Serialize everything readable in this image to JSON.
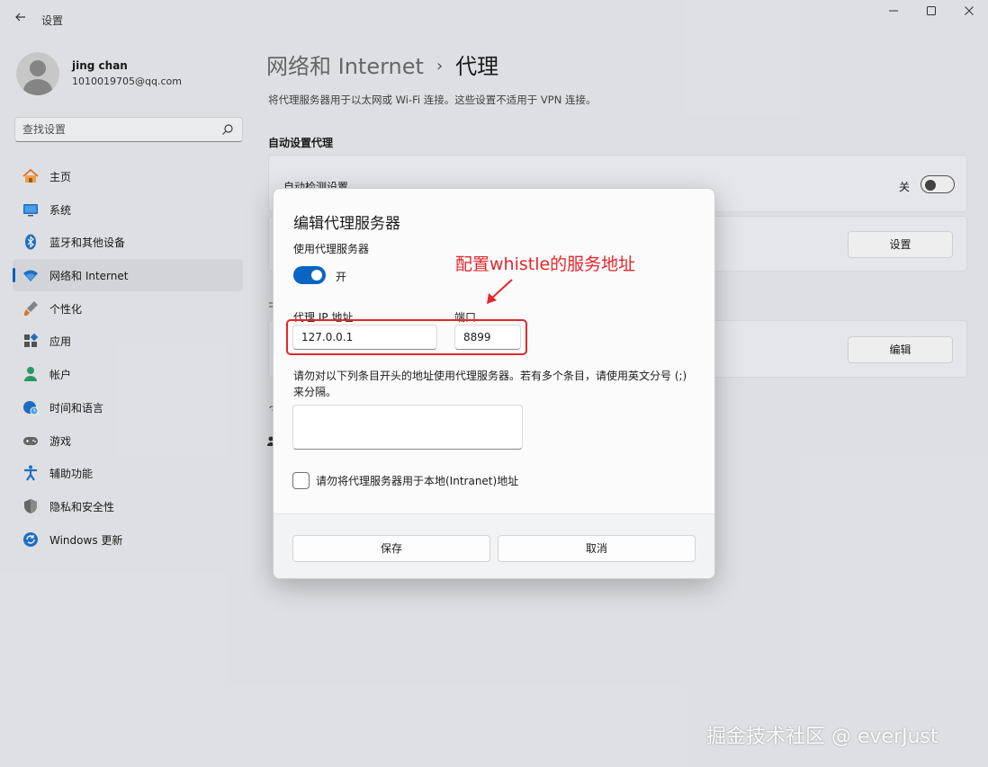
{
  "window": {
    "title": "设置"
  },
  "user": {
    "name": "jing chan",
    "email": "1010019705@qq.com"
  },
  "search": {
    "placeholder": "查找设置"
  },
  "sidebar": {
    "items": [
      {
        "label": "主页",
        "icon": "home-icon"
      },
      {
        "label": "系统",
        "icon": "system-icon"
      },
      {
        "label": "蓝牙和其他设备",
        "icon": "bluetooth-icon"
      },
      {
        "label": "网络和 Internet",
        "icon": "wifi-icon",
        "active": true
      },
      {
        "label": "个性化",
        "icon": "brush-icon"
      },
      {
        "label": "应用",
        "icon": "apps-icon"
      },
      {
        "label": "帐户",
        "icon": "account-icon"
      },
      {
        "label": "时间和语言",
        "icon": "globe-clock-icon"
      },
      {
        "label": "游戏",
        "icon": "gamepad-icon"
      },
      {
        "label": "辅助功能",
        "icon": "accessibility-icon"
      },
      {
        "label": "隐私和安全性",
        "icon": "shield-icon"
      },
      {
        "label": "Windows 更新",
        "icon": "update-icon"
      }
    ]
  },
  "main": {
    "breadcrumb_parent": "网络和 Internet",
    "breadcrumb_separator": "›",
    "breadcrumb_current": "代理",
    "description": "将代理服务器用于以太网或 Wi-Fi 连接。这些设置不适用于 VPN 连接。",
    "auto_section_title": "自动设置代理",
    "auto_detect_label": "自动检测设置",
    "auto_detect_state": "关",
    "setup_script_button": "设置",
    "manual_edit_button": "编辑"
  },
  "dialog": {
    "title": "编辑代理服务器",
    "use_proxy_label": "使用代理服务器",
    "use_proxy_state": "开",
    "ip_label": "代理 IP 地址",
    "ip_value": "127.0.0.1",
    "port_label": "端口",
    "port_value": "8899",
    "exclude_text": "请勿对以下列条目开头的地址使用代理服务器。若有多个条目，请使用英文分号 (;) 来分隔。",
    "exclude_value": "",
    "local_checkbox_label": "请勿将代理服务器用于本地(Intranet)地址",
    "save_button": "保存",
    "cancel_button": "取消"
  },
  "annotation": {
    "text": "配置whistle的服务地址",
    "color": "#e5262c"
  },
  "watermark": "掘金技术社区 @ everJust",
  "colors": {
    "accent": "#0a64c2",
    "background": "#e8e9ec",
    "annotation": "#e5262c"
  }
}
